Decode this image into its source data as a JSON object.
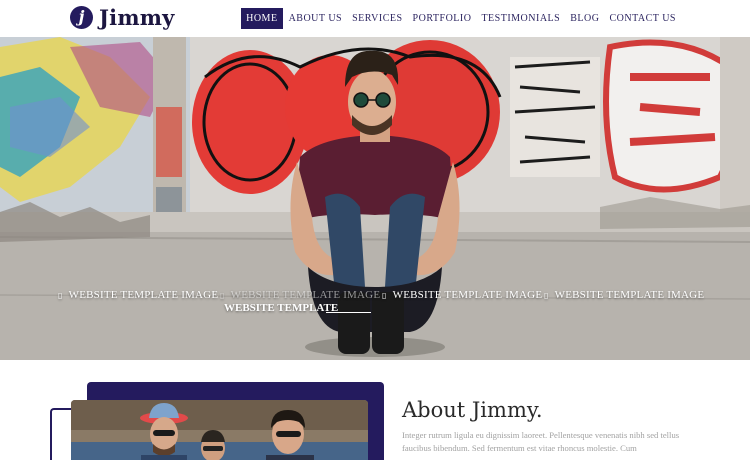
{
  "brand": {
    "logo_letter": "j",
    "name": "Jimmy",
    "accent": "#241b5e"
  },
  "nav": {
    "items": [
      {
        "label": "HOME",
        "active": true
      },
      {
        "label": "ABOUT US",
        "active": false
      },
      {
        "label": "SERVICES",
        "active": false
      },
      {
        "label": "PORTFOLIO",
        "active": false
      },
      {
        "label": "TESTIMONIALS",
        "active": false
      },
      {
        "label": "BLOG",
        "active": false
      },
      {
        "label": "CONTACT US",
        "active": false
      }
    ]
  },
  "hero": {
    "captions": [
      {
        "icon": "image-icon",
        "text": "WEBSITE TEMPLATE IMAGE"
      },
      {
        "icon": "image-icon",
        "text": "WEBSITE TEMPLATE IMAGE"
      },
      {
        "icon": "image-icon",
        "text": "WEBSITE TEMPLATE IMAGE"
      },
      {
        "icon": "image-icon",
        "text": "WEBSITE TEMPLATE IMAGE"
      }
    ],
    "slide_title": "WEBSITE TEMPLATE"
  },
  "about": {
    "title": "About Jimmy.",
    "text": "Integer rutrum ligula eu dignissim laoreet. Pellentesque venenatis nibh sed tellus faucibus bibendum. Sed fermentum est vitae rhoncus molestie. Cum"
  }
}
